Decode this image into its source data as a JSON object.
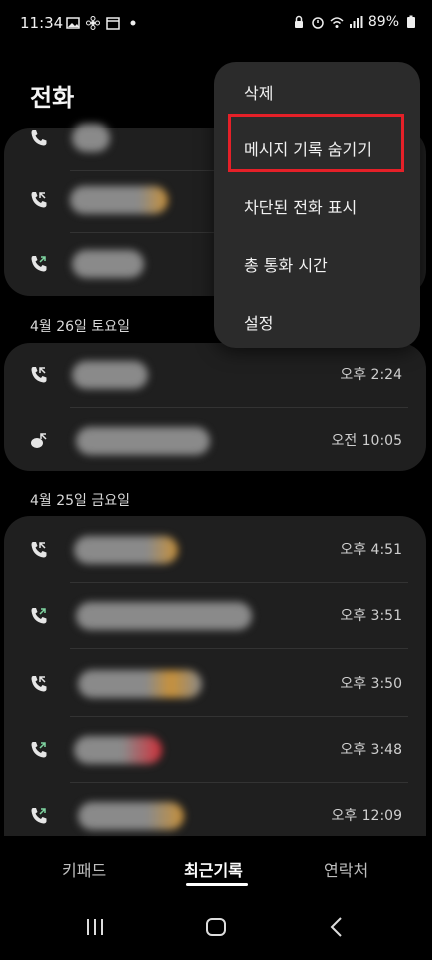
{
  "status": {
    "time": "11:34",
    "battery": "89%"
  },
  "header": {
    "title": "전화"
  },
  "menu": {
    "items": [
      "삭제",
      "메시지 기록 숨기기",
      "차단된 전화 표시",
      "총 통화 시간",
      "설정"
    ],
    "highlighted_index": 1,
    "highlight_color": "#e52028"
  },
  "call_log": {
    "group1_times": [
      "",
      "",
      ""
    ],
    "date_apr26": "4월 26일 토요일",
    "group2_times": [
      "오후 2:24",
      "오전 10:05"
    ],
    "date_apr25": "4월 25일 금요일",
    "group3_times": [
      "오후 4:51",
      "오후 3:51",
      "오후 3:50",
      "오후 3:48",
      "오후 12:09"
    ]
  },
  "tabs": {
    "keypad": "키패드",
    "recents": "최근기록",
    "contacts": "연락처",
    "active": "recents"
  },
  "colors": {
    "background": "#000000",
    "card": "#1f1f1f",
    "menu": "#2b2b2b",
    "incoming_icon": "#e6e6e6",
    "outgoing_icon": "#7fd4a0"
  }
}
